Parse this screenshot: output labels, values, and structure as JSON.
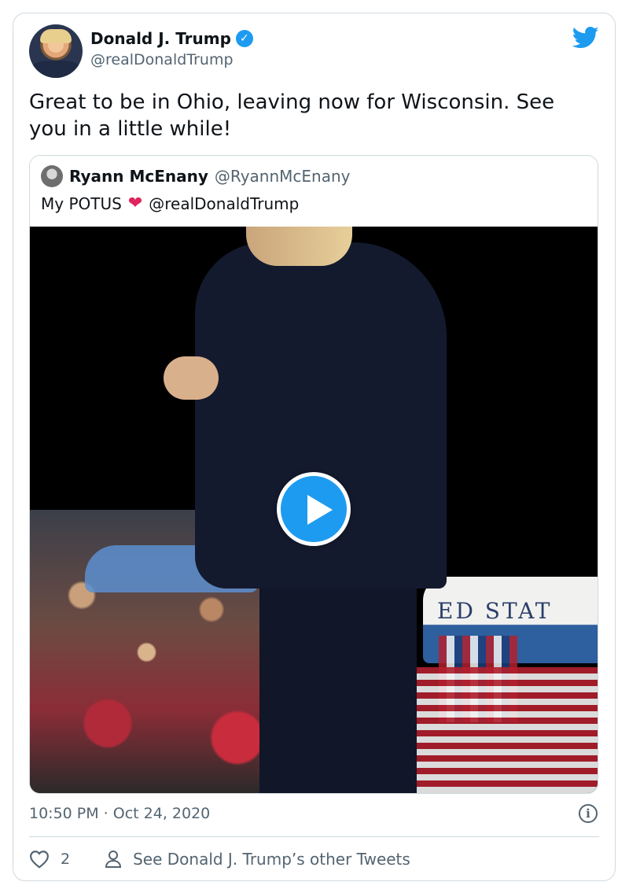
{
  "author": {
    "display_name": "Donald J. Trump",
    "verified_mark": "✓",
    "handle": "@realDonaldTrump"
  },
  "tweet": {
    "text": "Great to be in Ohio, leaving now for Wisconsin. See you in a little while!"
  },
  "quoted": {
    "display_name": "Ryann McEnany",
    "handle": "@RyannMcEnany",
    "text_before": "My POTUS",
    "emoji": "❤",
    "mention": "@realDonaldTrump",
    "media_caption_text": "ED STAT"
  },
  "meta": {
    "timestamp": "10:50 PM · Oct 24, 2020",
    "info_glyph": "i"
  },
  "footer": {
    "like_count": "2",
    "other_tweets_label": "See Donald J. Trump’s other Tweets"
  },
  "colors": {
    "brand": "#1d9bf0",
    "secondary_text": "#536471",
    "border": "#cfd9de",
    "heart": "#e0245e"
  },
  "icons": [
    "twitter-logo-icon",
    "verified-badge-icon",
    "play-icon",
    "info-icon",
    "heart-outline-icon",
    "person-icon"
  ]
}
